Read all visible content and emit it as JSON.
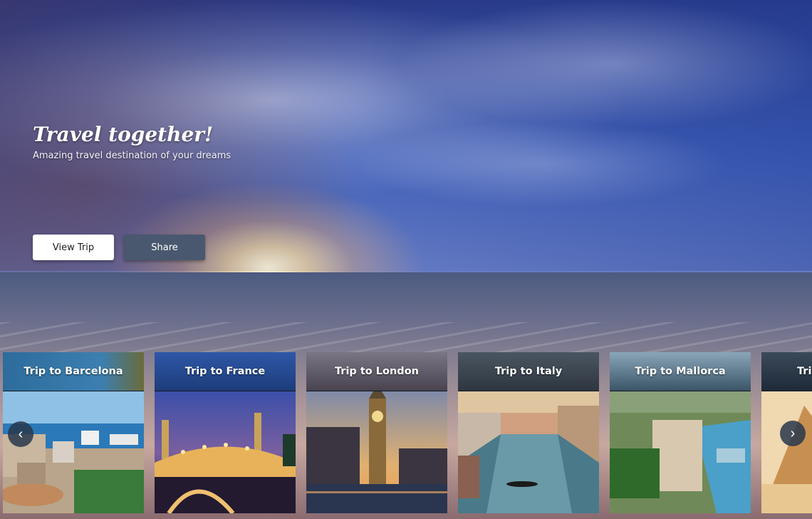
{
  "hero": {
    "title": "Travel together!",
    "subtitle": "Amazing travel destination of your dreams",
    "primary_button": "View Trip",
    "secondary_button": "Share"
  },
  "carousel": {
    "cards": [
      {
        "title": "Trip to Barcelona"
      },
      {
        "title": "Trip to France"
      },
      {
        "title": "Trip to London"
      },
      {
        "title": "Trip to Italy"
      },
      {
        "title": "Trip to Mallorca"
      },
      {
        "title": "Tri"
      }
    ],
    "prev_icon": "chevron-left-icon",
    "next_icon": "chevron-right-icon"
  },
  "colors": {
    "secondary_button": "#49586e",
    "primary_button": "#ffffff"
  }
}
